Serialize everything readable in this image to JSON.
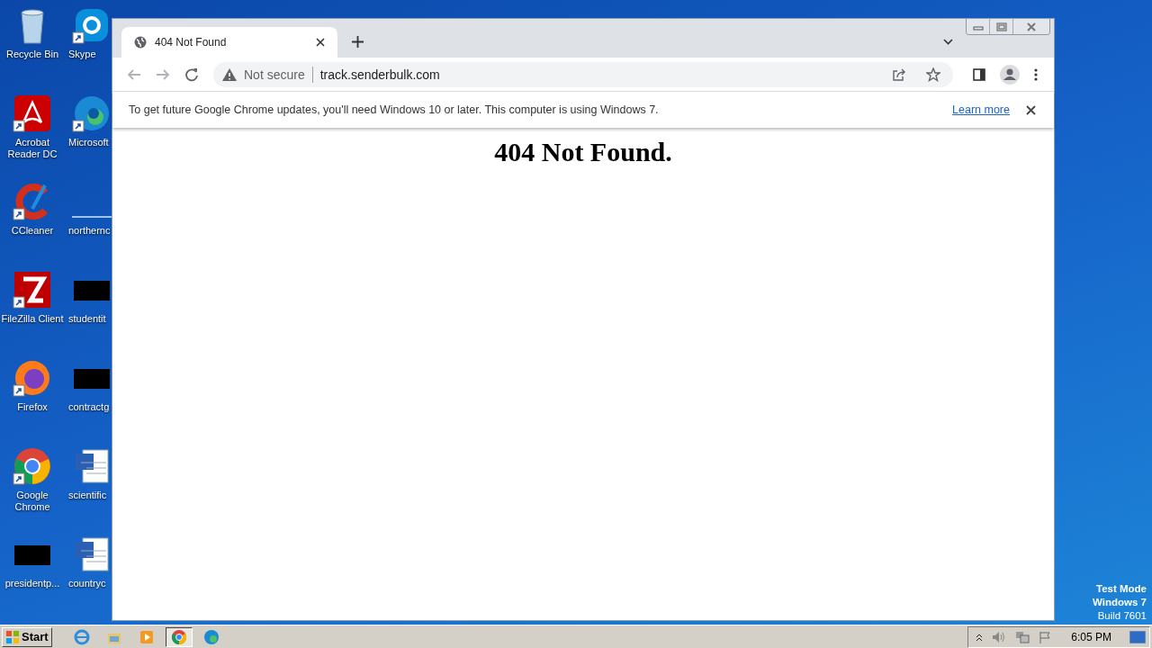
{
  "desktop_icons": [
    {
      "label": "Recycle Bin",
      "kind": "recycle",
      "shortcut": false
    },
    {
      "label": "Skype",
      "kind": "skype",
      "shortcut": true
    },
    {
      "label": "Acrobat Reader DC",
      "kind": "acrobat",
      "shortcut": true
    },
    {
      "label": "Microsoft",
      "kind": "edge",
      "shortcut": true
    },
    {
      "label": "CCleaner",
      "kind": "ccleaner",
      "shortcut": true
    },
    {
      "label": "northernc",
      "kind": "line",
      "shortcut": false
    },
    {
      "label": "FileZilla Client",
      "kind": "filezilla",
      "shortcut": true
    },
    {
      "label": "studentit",
      "kind": "black",
      "shortcut": false
    },
    {
      "label": "Firefox",
      "kind": "firefox",
      "shortcut": true
    },
    {
      "label": "contractg",
      "kind": "black",
      "shortcut": false
    },
    {
      "label": "Google Chrome",
      "kind": "chrome",
      "shortcut": true
    },
    {
      "label": "scientific",
      "kind": "word",
      "shortcut": false
    },
    {
      "label": "presidentp...",
      "kind": "black",
      "shortcut": false
    },
    {
      "label": "countryc",
      "kind": "word",
      "shortcut": false
    }
  ],
  "browser": {
    "tab": {
      "title": "404 Not Found",
      "selected": true
    },
    "security": "Not secure",
    "url": "track.senderbulk.com",
    "infobar": {
      "message": "To get future Google Chrome updates, you'll need Windows 10 or later. This computer is using Windows 7.",
      "link": "Learn more"
    },
    "page": {
      "heading": "404 Not Found."
    }
  },
  "os_notice": [
    "Test Mode",
    "Windows 7",
    "Build 7601"
  ],
  "taskbar": {
    "start": "Start",
    "apps": [
      {
        "kind": "ie",
        "selected": false
      },
      {
        "kind": "explorer",
        "selected": false
      },
      {
        "kind": "media",
        "selected": false
      },
      {
        "kind": "chrome",
        "selected": true
      },
      {
        "kind": "edge",
        "selected": false
      }
    ],
    "time": "6:05 PM"
  }
}
